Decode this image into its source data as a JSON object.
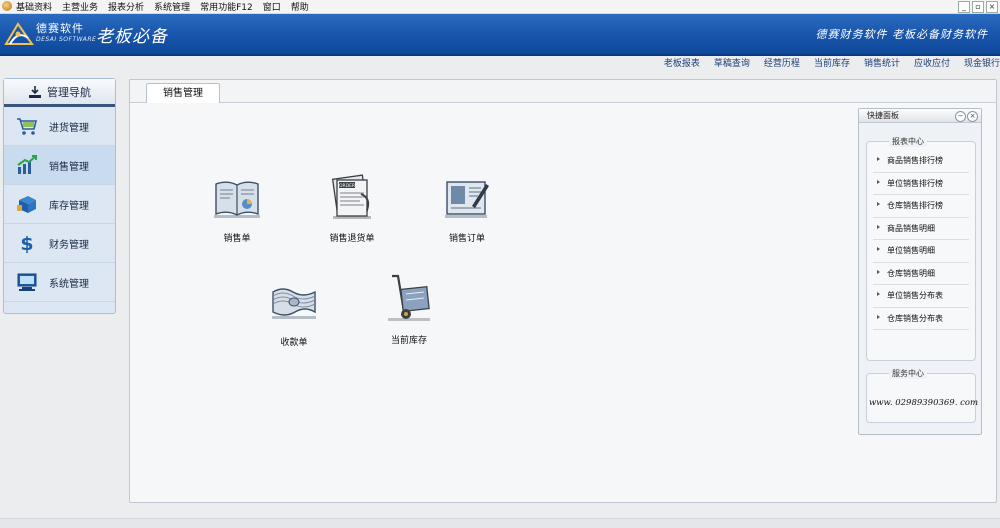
{
  "menubar": {
    "items": [
      "基础资料",
      "主营业务",
      "报表分析",
      "系统管理",
      "常用功能F12",
      "窗口",
      "帮助"
    ],
    "window_controls": [
      "_",
      "▫",
      "×"
    ]
  },
  "header": {
    "brand_cn": "德赛软件",
    "brand_en": "DESAI SOFTWARE",
    "app_title": "老板必备",
    "slogan": "德赛财务软件 老板必备财务软件"
  },
  "quicklinks": [
    "老板报表",
    "草稿查询",
    "经营历程",
    "当前库存",
    "销售统计",
    "应收应付",
    "现金银行"
  ],
  "nav": {
    "title": "管理导航",
    "items": [
      {
        "label": "进货管理",
        "icon": "shopping-cart-icon"
      },
      {
        "label": "销售管理",
        "icon": "sales-chart-icon"
      },
      {
        "label": "库存管理",
        "icon": "inventory-box-icon"
      },
      {
        "label": "财务管理",
        "icon": "dollar-icon"
      },
      {
        "label": "系统管理",
        "icon": "computer-icon"
      }
    ],
    "active_index": 1
  },
  "main": {
    "tab_label": "销售管理",
    "functions": [
      {
        "label": "销售单",
        "icon": "sales-document-icon"
      },
      {
        "label": "销售退货单",
        "icon": "return-order-icon"
      },
      {
        "label": "销售订单",
        "icon": "sales-order-icon"
      },
      {
        "label": "收款单",
        "icon": "receipt-cash-icon"
      },
      {
        "label": "当前库存",
        "icon": "hand-truck-icon"
      }
    ]
  },
  "quick_panel": {
    "title": "快捷面板",
    "report_center": {
      "title": "报表中心",
      "items": [
        "商品销售排行榜",
        "单位销售排行榜",
        "仓库销售排行榜",
        "商品销售明细",
        "单位销售明细",
        "仓库销售明细",
        "单位销售分布表",
        "仓库销售分布表"
      ]
    },
    "service_center": {
      "title": "服务中心",
      "url": "www. 02989390369. com"
    }
  },
  "colors": {
    "header_blue": "#1a58ad",
    "nav_bg": "#dce7f3"
  }
}
